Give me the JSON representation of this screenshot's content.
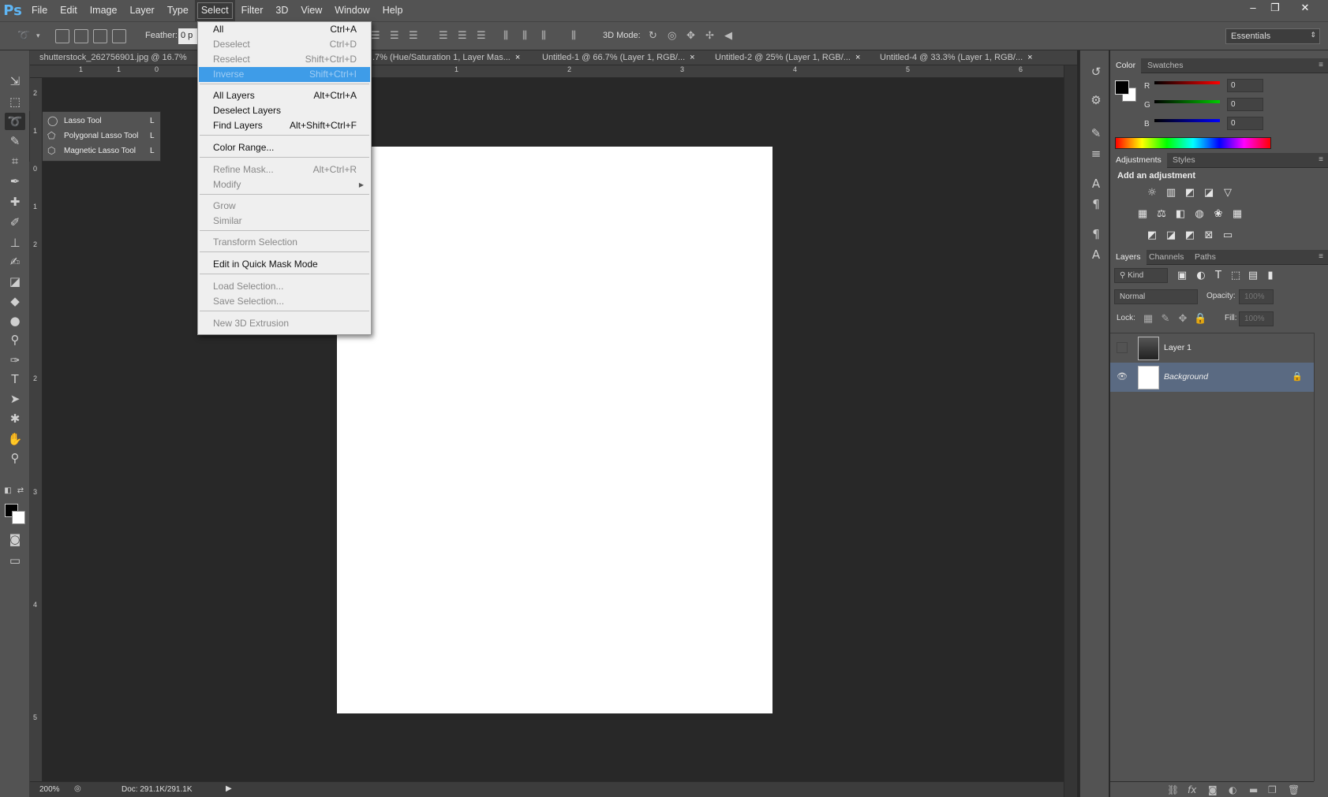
{
  "app": {
    "logo": "Ps"
  },
  "menubar": {
    "items": [
      "File",
      "Edit",
      "Image",
      "Layer",
      "Type",
      "Select",
      "Filter",
      "3D",
      "View",
      "Window",
      "Help"
    ]
  },
  "window_controls": {
    "minimize": "–",
    "restore": "❐",
    "close": "✕"
  },
  "options": {
    "feather_label": "Feather:",
    "feather_value": "0 p",
    "mode3d_label": "3D Mode:",
    "workspace": "Essentials"
  },
  "doc_tabs": [
    {
      "label": "shutterstock_262756901.jpg @ 16.7%",
      "close": ""
    },
    {
      "label": ".7% (Hue/Saturation 1, Layer Mas...",
      "close": "×"
    },
    {
      "label": "Untitled-1 @ 66.7% (Layer 1, RGB/...",
      "close": "×"
    },
    {
      "label": "Untitled-2 @ 25% (Layer 1, RGB/...",
      "close": "×"
    },
    {
      "label": "Untitled-4 @ 33.3% (Layer 1, RGB/...",
      "close": "×"
    }
  ],
  "ruler_top": [
    "1",
    "1",
    "0",
    "1",
    "2",
    "3",
    "4",
    "5",
    "6"
  ],
  "ruler_left": [
    "2",
    "1",
    "0",
    "1",
    "2",
    "2",
    "3",
    "4",
    "5"
  ],
  "flyout": {
    "items": [
      {
        "label": "Lasso Tool",
        "shortcut": "L",
        "selected": ""
      },
      {
        "label": "Polygonal Lasso Tool",
        "shortcut": "L",
        "selected": ""
      },
      {
        "label": "Magnetic Lasso Tool",
        "shortcut": "L",
        "selected": "■"
      }
    ]
  },
  "select_menu": {
    "items": [
      {
        "label": "All",
        "shortcut": "Ctrl+A"
      },
      {
        "label": "Deselect",
        "shortcut": "Ctrl+D"
      },
      {
        "label": "Reselect",
        "shortcut": "Shift+Ctrl+D"
      },
      {
        "label": "Inverse",
        "shortcut": "Shift+Ctrl+I"
      },
      {
        "label": "All Layers",
        "shortcut": "Alt+Ctrl+A"
      },
      {
        "label": "Deselect Layers",
        "shortcut": ""
      },
      {
        "label": "Find Layers",
        "shortcut": "Alt+Shift+Ctrl+F"
      },
      {
        "label": "Color Range...",
        "shortcut": ""
      },
      {
        "label": "Refine Mask...",
        "shortcut": "Alt+Ctrl+R"
      },
      {
        "label": "Modify",
        "shortcut": ""
      },
      {
        "label": "Grow",
        "shortcut": ""
      },
      {
        "label": "Similar",
        "shortcut": ""
      },
      {
        "label": "Transform Selection",
        "shortcut": ""
      },
      {
        "label": "Edit in Quick Mask Mode",
        "shortcut": ""
      },
      {
        "label": "Load Selection...",
        "shortcut": ""
      },
      {
        "label": "Save Selection...",
        "shortcut": ""
      },
      {
        "label": "New 3D Extrusion",
        "shortcut": ""
      }
    ]
  },
  "status": {
    "zoom": "200%",
    "doc": "Doc: 291.1K/291.1K",
    "arrow": "▶"
  },
  "color_panel": {
    "tabs": [
      "Color",
      "Swatches"
    ],
    "channels": [
      {
        "name": "R",
        "value": "0",
        "color": "#e02020"
      },
      {
        "name": "G",
        "value": "0",
        "color": "#20b020"
      },
      {
        "name": "B",
        "value": "0",
        "color": "#2040e0"
      }
    ]
  },
  "adjustments_panel": {
    "tabs": [
      "Adjustments",
      "Styles"
    ],
    "heading": "Add an adjustment"
  },
  "layers_panel": {
    "tabs": [
      "Layers",
      "Channels",
      "Paths"
    ],
    "kind": "Kind",
    "blend_mode": "Normal",
    "opacity_label": "Opacity:",
    "opacity_value": "100%",
    "lock_label": "Lock:",
    "fill_label": "Fill:",
    "fill_value": "100%",
    "layers": [
      {
        "name": "Layer 1",
        "visible_icon": ""
      },
      {
        "name": "Background",
        "visible_icon": "👁"
      }
    ]
  }
}
